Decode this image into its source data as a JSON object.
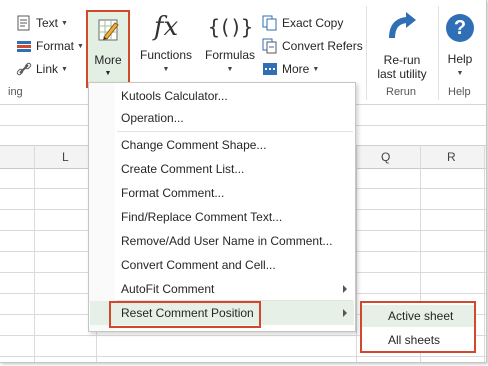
{
  "ribbon": {
    "small_buttons_left": [
      {
        "label": "Text",
        "icon": "text-icon"
      },
      {
        "label": "Format",
        "icon": "format-icon"
      },
      {
        "label": "Link",
        "icon": "link-icon"
      }
    ],
    "left_group_label": "ing",
    "more_button": {
      "label": "More",
      "icon": "pencil-edit-icon"
    },
    "functions_button": {
      "label": "Functions",
      "icon_text": "fx"
    },
    "formulas_button": {
      "label": "Formulas",
      "icon_text": "{()}"
    },
    "small_buttons_right": [
      {
        "label": "Exact Copy",
        "icon": "copy-icon"
      },
      {
        "label": "Convert Refers",
        "icon": "convert-icon"
      },
      {
        "label": "More",
        "icon": "more-grid-icon"
      }
    ],
    "rerun": {
      "label_line1": "Re-run",
      "label_line2": "last utility",
      "group_label": "Rerun",
      "icon": "rerun-arrow-icon"
    },
    "help": {
      "label": "Help",
      "group_label": "Help",
      "icon": "help-icon",
      "glyph": "?"
    }
  },
  "sheet": {
    "columns": [
      "L",
      "Q",
      "R"
    ]
  },
  "menu": {
    "items": [
      {
        "label": "Kutools Calculator...",
        "has_submenu": false
      },
      {
        "label": "Operation...",
        "has_submenu": false
      },
      {
        "label": "Change Comment Shape...",
        "has_submenu": false
      },
      {
        "label": "Create Comment List...",
        "has_submenu": false
      },
      {
        "label": "Format Comment...",
        "has_submenu": false
      },
      {
        "label": "Find/Replace Comment Text...",
        "has_submenu": false
      },
      {
        "label": "Remove/Add User Name in Comment...",
        "has_submenu": false
      },
      {
        "label": "Convert Comment and Cell...",
        "has_submenu": false
      },
      {
        "label": "AutoFit Comment",
        "has_submenu": true
      },
      {
        "label": "Reset Comment Position",
        "has_submenu": true
      }
    ]
  },
  "submenu": {
    "items": [
      {
        "label": "Active sheet"
      },
      {
        "label": "All sheets"
      }
    ]
  },
  "colors": {
    "highlight_border": "#d0492b",
    "hover_bg": "#e6f0e6",
    "ribbon_icon_blue": "#2e6fb6"
  }
}
